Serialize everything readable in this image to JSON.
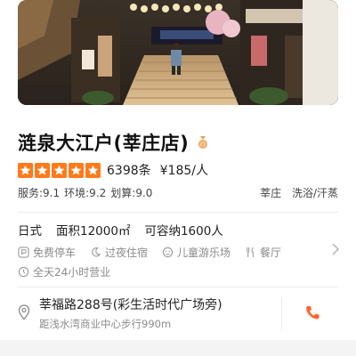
{
  "shop": {
    "name": "涟泉大江户(莘庄店)",
    "reviews": "6398条",
    "price": "¥185/人",
    "rating_stars": 5,
    "scores": [
      "服务:9.1",
      "环境:9.2",
      "划算:9.0"
    ],
    "tags": [
      "莘庄",
      "洗浴/汗蒸"
    ]
  },
  "details": {
    "info": [
      "日式",
      "面积12000㎡",
      "可容纳1600人"
    ],
    "facilities": [
      {
        "label": "免费停车",
        "icon": "parking-icon"
      },
      {
        "label": "过夜住宿",
        "icon": "moon-icon"
      },
      {
        "label": "儿童游乐场",
        "icon": "kids-icon"
      },
      {
        "label": "餐厅",
        "icon": "restaurant-icon"
      }
    ],
    "hours": "全天24小时营业"
  },
  "address": {
    "line": "莘福路288号(彩生活时代广场旁)",
    "distance": "距浅水湾商业中心步行990m"
  },
  "colors": {
    "star": "#ff7a1a",
    "phone": "#ff6633",
    "muted": "#8a8a8a"
  }
}
